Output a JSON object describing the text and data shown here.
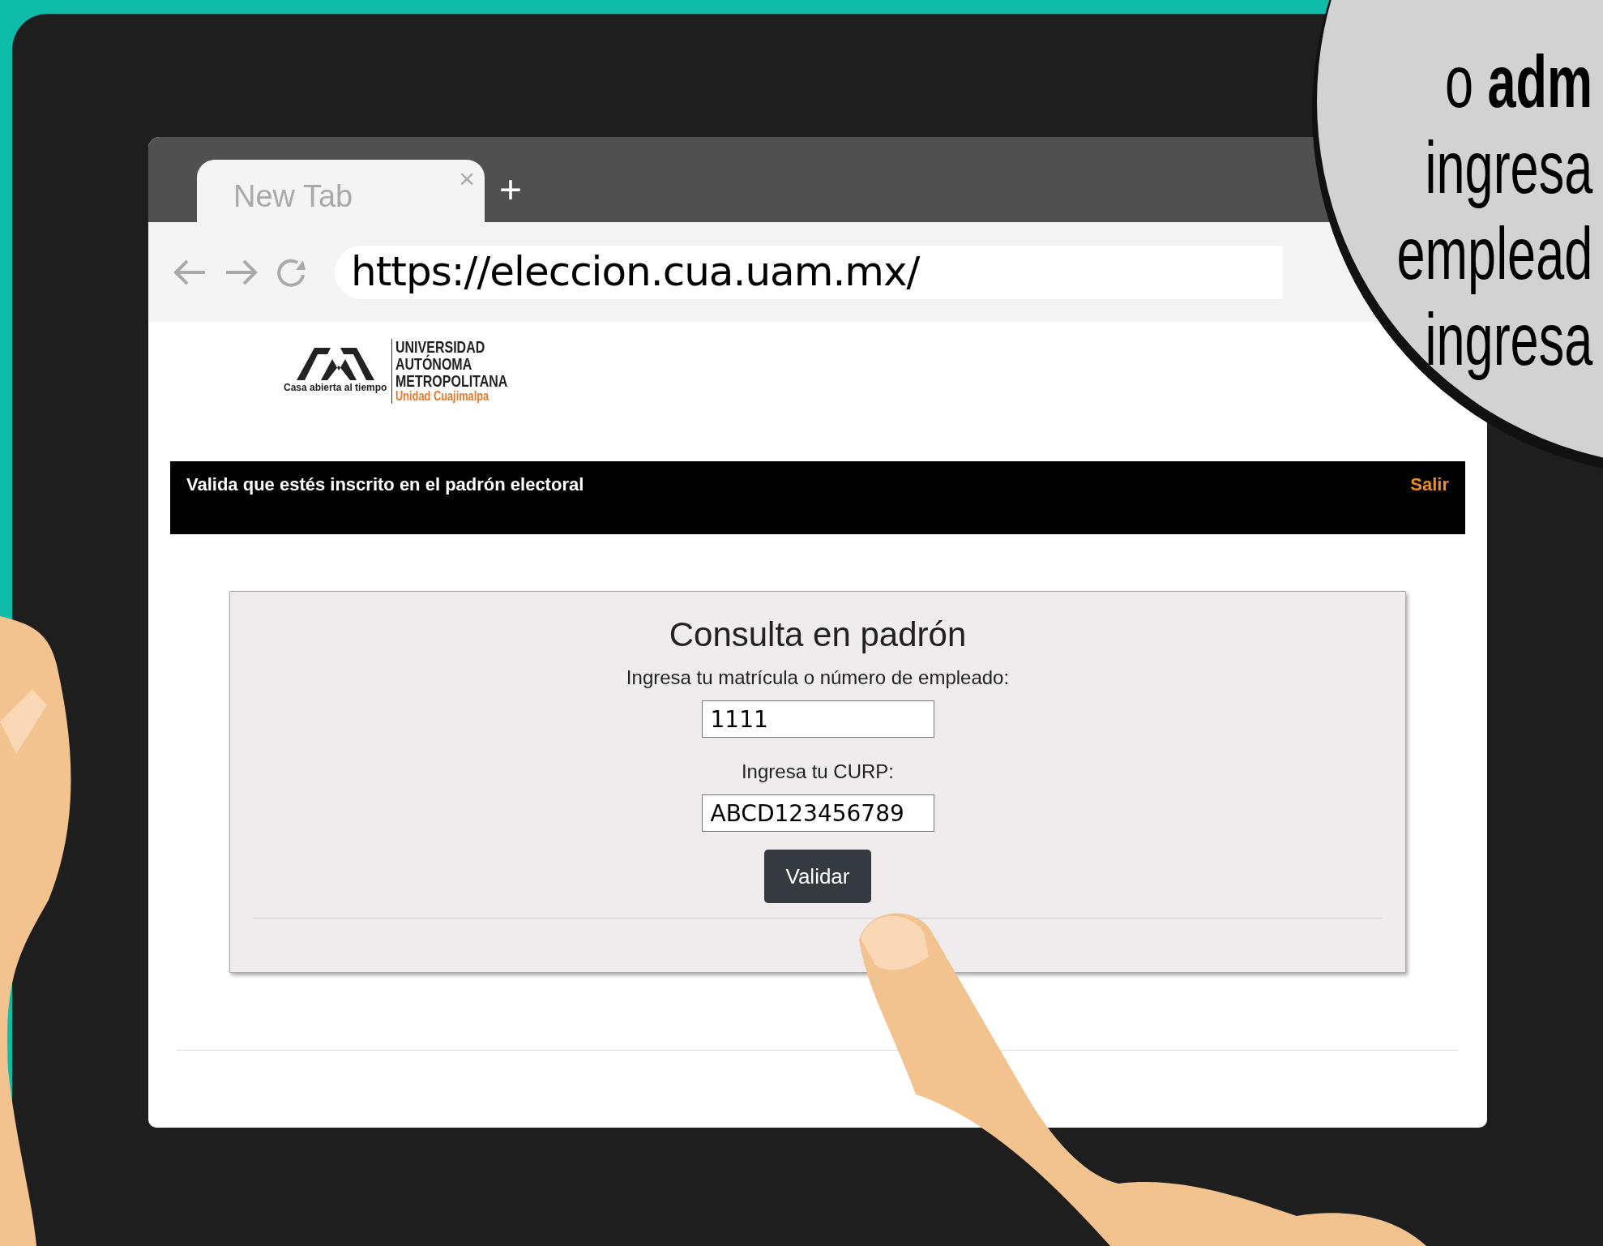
{
  "browser": {
    "tab_title": "New Tab",
    "close_tab": "×",
    "new_tab": "+",
    "url": "https://eleccion.cua.uam.mx/"
  },
  "page": {
    "logo": {
      "tagline": "Casa abierta al tiempo",
      "lines": [
        "UNIVERSIDAD",
        "AUTÓNOMA",
        "METROPOLITANA"
      ],
      "unit": "Unidad Cuajimalpa"
    },
    "navbar": {
      "title": "Valida que estés inscrito en el padrón electoral",
      "link": "Salir"
    },
    "form": {
      "title": "Consulta en padrón",
      "fields": [
        {
          "label": "Ingresa tu matrícula o número de empleado:",
          "value": "1111"
        },
        {
          "label": "Ingresa tu CURP:",
          "value": "ABCD123456789"
        }
      ],
      "button": "Validar"
    }
  },
  "callout": {
    "lines": [
      "o **adm**",
      "ingresa",
      "emplead",
      "ingresa"
    ]
  }
}
